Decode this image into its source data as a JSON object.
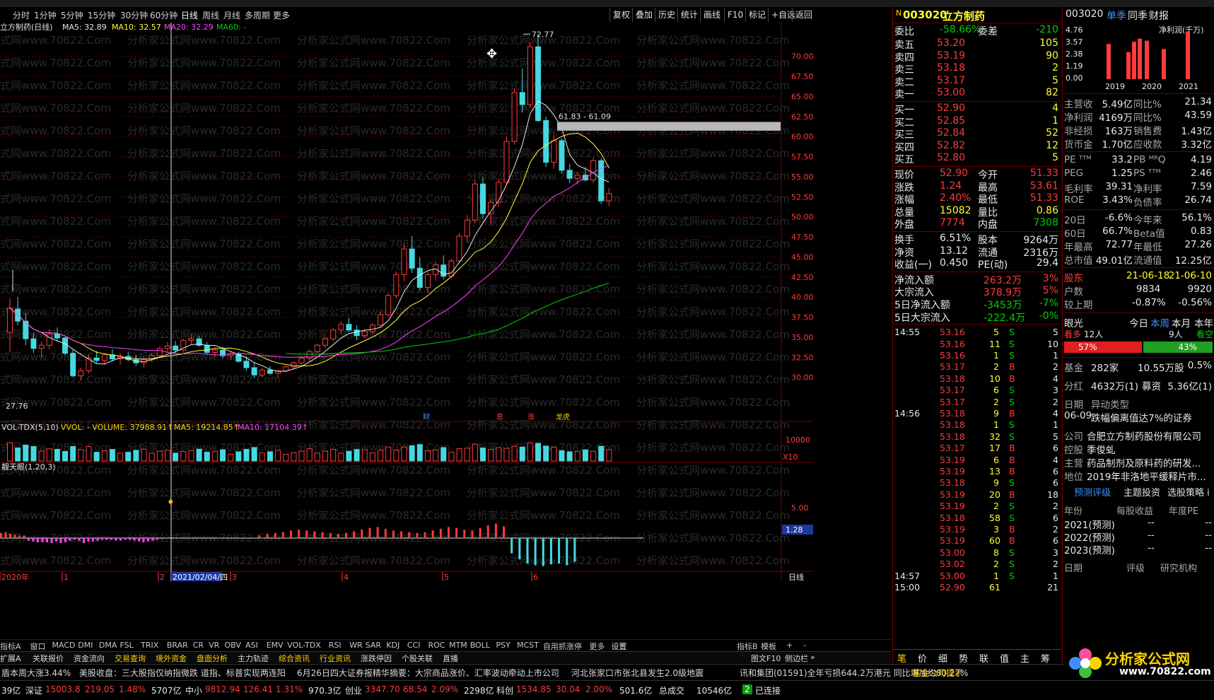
{
  "colors": {
    "up": "#ff3b3b",
    "down": "#44d9e0",
    "ma5": "#e8e8e8",
    "ma10": "#ffff30",
    "ma20": "#ff40ff",
    "ma60": "#00d000",
    "grid": "#7a0000"
  },
  "toolbar": {
    "periods": [
      "分时",
      "1分钟",
      "5分钟",
      "15分钟",
      "30分钟",
      "60分钟",
      "日线",
      "周线",
      "月线",
      "多周期",
      "更多"
    ],
    "active_period": "日线",
    "right_buttons": [
      "复权",
      "叠加",
      "历史",
      "统计",
      "画线",
      "F10",
      "标记",
      "+自选",
      "返回"
    ]
  },
  "chart": {
    "stock_label": "立方制药(日线)",
    "ma5": "MA5: 32.89",
    "ma10": "MA10: 32.57",
    "ma20": "MA20: 32.29",
    "ma60": "MA60: -",
    "high_label": "72.77",
    "low_label": "27.76",
    "gap_label": "61.83 - 61.09",
    "watermark": "分析家公式网www.70822.Com",
    "event_markers": [
      "财",
      "息",
      "涨",
      "龙虎"
    ],
    "vol_label": "VOL-TDX(5,10)",
    "vol_value": "VVOL: -   VOLUME: 37988.91↑",
    "vol_ma5": "MA5: 19214.85↑",
    "vol_ma10": "MA10: 17104.39↑",
    "vol_scale": "10000",
    "vol_unit": "X10",
    "ind_label": "靓天眼(1.20,3)",
    "ind_scale": "5.00",
    "ind_value": "1.28",
    "date_axis": [
      "2020年",
      "1",
      "2",
      "2021/02/04/四",
      "3",
      "4",
      "5",
      "6"
    ],
    "axis_unit": "日线"
  },
  "chart_data": {
    "type": "candlestick",
    "y_ticks": [
      70.0,
      67.5,
      65.0,
      62.5,
      60.0,
      57.5,
      55.0,
      52.5,
      50.0,
      47.5,
      45.0,
      42.5,
      40.0,
      37.5,
      35.0,
      32.5,
      30.0
    ],
    "ylim": [
      27.5,
      73.5
    ],
    "candles": [
      [
        35.6,
        39.8,
        33.2,
        38.6
      ],
      [
        38.5,
        40.0,
        36.5,
        37.0
      ],
      [
        37.0,
        38.0,
        34.0,
        34.8
      ],
      [
        34.8,
        35.5,
        33.0,
        33.6
      ],
      [
        33.6,
        34.5,
        32.5,
        34.0
      ],
      [
        34.0,
        36.0,
        33.5,
        35.4
      ],
      [
        35.4,
        36.2,
        34.5,
        34.9
      ],
      [
        34.9,
        35.0,
        32.8,
        33.0
      ],
      [
        33.0,
        33.5,
        30.0,
        30.2
      ],
      [
        30.2,
        31.2,
        29.6,
        30.8
      ],
      [
        30.8,
        32.8,
        30.5,
        32.4
      ],
      [
        32.4,
        33.3,
        31.8,
        32.1
      ],
      [
        32.1,
        33.0,
        31.5,
        32.8
      ],
      [
        32.8,
        33.5,
        32.0,
        32.3
      ],
      [
        32.3,
        33.0,
        31.6,
        32.6
      ],
      [
        32.6,
        33.2,
        32.0,
        32.2
      ],
      [
        32.2,
        32.8,
        31.4,
        31.8
      ],
      [
        31.8,
        32.5,
        31.2,
        32.3
      ],
      [
        32.3,
        33.0,
        31.9,
        32.7
      ],
      [
        32.7,
        33.8,
        32.4,
        33.6
      ],
      [
        33.6,
        34.4,
        33.2,
        33.9
      ],
      [
        33.9,
        34.5,
        33.0,
        33.4
      ],
      [
        33.4,
        34.8,
        33.2,
        34.6
      ],
      [
        34.6,
        35.4,
        34.0,
        34.8
      ],
      [
        34.8,
        35.2,
        33.8,
        34.0
      ],
      [
        34.0,
        34.4,
        32.8,
        33.1
      ],
      [
        33.1,
        33.8,
        32.6,
        33.4
      ],
      [
        33.4,
        33.8,
        32.4,
        32.7
      ],
      [
        32.7,
        33.2,
        32.2,
        32.9
      ],
      [
        32.9,
        33.2,
        31.8,
        32.0
      ],
      [
        32.0,
        32.6,
        30.8,
        31.2
      ],
      [
        31.2,
        31.8,
        29.9,
        30.3
      ],
      [
        30.3,
        31.2,
        30.0,
        30.9
      ],
      [
        30.9,
        31.4,
        30.3,
        30.5
      ],
      [
        30.5,
        31.0,
        30.0,
        30.8
      ],
      [
        30.8,
        31.5,
        30.6,
        31.3
      ],
      [
        31.3,
        32.0,
        31.0,
        31.8
      ],
      [
        31.8,
        32.6,
        31.5,
        32.4
      ],
      [
        32.4,
        33.5,
        32.0,
        33.2
      ],
      [
        33.2,
        34.2,
        33.0,
        34.0
      ],
      [
        34.0,
        35.0,
        33.6,
        34.8
      ],
      [
        34.8,
        36.2,
        34.5,
        35.9
      ],
      [
        35.9,
        37.0,
        35.4,
        36.6
      ],
      [
        36.6,
        37.4,
        35.6,
        35.9
      ],
      [
        35.9,
        36.5,
        34.6,
        35.2
      ],
      [
        35.2,
        36.0,
        34.8,
        35.7
      ],
      [
        35.7,
        36.8,
        35.4,
        36.5
      ],
      [
        36.5,
        38.2,
        36.2,
        37.8
      ],
      [
        37.8,
        40.5,
        37.5,
        40.2
      ],
      [
        40.2,
        43.2,
        39.8,
        42.8
      ],
      [
        42.8,
        46.6,
        42.0,
        46.0
      ],
      [
        46.0,
        47.6,
        43.0,
        43.6
      ],
      [
        43.6,
        45.0,
        40.8,
        41.2
      ],
      [
        41.2,
        43.2,
        40.5,
        42.8
      ],
      [
        42.8,
        44.5,
        42.0,
        44.0
      ],
      [
        44.0,
        45.2,
        42.2,
        42.6
      ],
      [
        42.6,
        44.8,
        42.4,
        44.5
      ],
      [
        44.5,
        48.0,
        44.2,
        47.6
      ],
      [
        47.6,
        50.2,
        46.8,
        49.6
      ],
      [
        49.6,
        54.6,
        49.2,
        54.1
      ],
      [
        54.1,
        55.0,
        49.8,
        50.4
      ],
      [
        50.4,
        52.2,
        49.0,
        51.8
      ],
      [
        51.8,
        54.8,
        51.2,
        54.3
      ],
      [
        54.3,
        60.0,
        54.0,
        59.4
      ],
      [
        59.4,
        66.0,
        59.0,
        65.5
      ],
      [
        65.5,
        68.5,
        63.0,
        64.0
      ],
      [
        64.0,
        71.8,
        63.6,
        71.2
      ],
      [
        71.2,
        72.77,
        61.8,
        62.0
      ],
      [
        62.0,
        62.5,
        56.2,
        56.8
      ],
      [
        56.8,
        60.2,
        56.0,
        59.5
      ],
      [
        59.5,
        59.8,
        55.4,
        55.8
      ],
      [
        55.8,
        56.6,
        54.2,
        54.8
      ],
      [
        54.8,
        55.6,
        54.0,
        55.2
      ],
      [
        55.2,
        56.2,
        54.4,
        54.6
      ],
      [
        54.6,
        57.4,
        54.2,
        57.0
      ],
      [
        57.0,
        57.3,
        51.6,
        52.0
      ],
      [
        52.0,
        53.61,
        51.33,
        52.9
      ]
    ],
    "ind_bars": [
      0.6,
      0.7,
      0.5,
      0.4,
      0.3,
      0.3,
      -0.3,
      -0.4,
      -0.5,
      -0.5,
      -0.5,
      -0.6,
      -0.4,
      -0.6,
      -0.5,
      -0.3,
      -0.2,
      -0.3,
      -0.6,
      -0.4,
      -0.4,
      -0.3,
      -0.2,
      -0.2,
      -0.2,
      -0.3,
      -0.3,
      -0.2,
      -0.2,
      -0.3,
      -0.4,
      -0.5,
      -0.4,
      -0.3,
      -0.2,
      -0.1,
      0.3,
      0.5,
      0.6,
      0.7,
      0.9,
      1.0,
      0.9,
      0.8,
      0.7,
      0.6,
      0.5,
      0.6,
      0.8,
      1.0,
      1.2,
      1.3,
      1.1,
      0.9,
      0.8,
      0.7,
      0.6,
      0.7,
      0.9,
      1.1,
      1.3,
      1.2,
      1.0,
      0.9,
      1.2,
      1.5,
      1.7,
      1.4,
      -1.8,
      -2.5,
      -3.0,
      -3.2,
      -3.3,
      -3.1,
      -3.0,
      -3.2,
      -2.8
    ]
  },
  "quote": {
    "code": "003020",
    "name": "立方制药",
    "weibi_label": "委比",
    "weibi": "-58.66%",
    "weicha_label": "委差",
    "weicha": "-210",
    "asks": [
      {
        "l": "卖五",
        "p": "53.20",
        "v": "105"
      },
      {
        "l": "卖四",
        "p": "53.19",
        "v": "90"
      },
      {
        "l": "卖三",
        "p": "53.18",
        "v": "2"
      },
      {
        "l": "卖二",
        "p": "53.17",
        "v": "5"
      },
      {
        "l": "卖一",
        "p": "53.00",
        "v": "82"
      }
    ],
    "bids": [
      {
        "l": "买一",
        "p": "52.90",
        "v": "4"
      },
      {
        "l": "买二",
        "p": "52.85",
        "v": "1"
      },
      {
        "l": "买三",
        "p": "52.84",
        "v": "52"
      },
      {
        "l": "买四",
        "p": "52.82",
        "v": "12"
      },
      {
        "l": "买五",
        "p": "52.80",
        "v": "5"
      }
    ],
    "stats": [
      {
        "a": "现价",
        "b": "52.90",
        "c": "今开",
        "d": "51.33"
      },
      {
        "a": "涨跌",
        "b": "1.24",
        "c": "最高",
        "d": "53.61"
      },
      {
        "a": "涨幅",
        "b": "2.40%",
        "c": "最低",
        "d": "51.33"
      },
      {
        "a": "总量",
        "b": "15082",
        "c": "量比",
        "d": "0.86"
      },
      {
        "a": "外盘",
        "b": "7774",
        "c": "内盘",
        "d": "7308"
      }
    ],
    "stats2": [
      {
        "a": "换手",
        "b": "6.51%",
        "c": "股本",
        "d": "9264万"
      },
      {
        "a": "净资",
        "b": "13.12",
        "c": "流通",
        "d": "2316万"
      },
      {
        "a": "收益(一)",
        "b": "0.450",
        "c": "PE(动)",
        "d": "29.4"
      }
    ],
    "flows": [
      {
        "a": "净流入额",
        "b": "263.2万",
        "c": "3%"
      },
      {
        "a": "大宗流入",
        "b": "378.9万",
        "c": "5%"
      },
      {
        "a": "5日净流入额",
        "b": "-3453万",
        "c": "-7%"
      },
      {
        "a": "5日大宗流入",
        "b": "-222.4万",
        "c": "-0%"
      }
    ],
    "ticks": [
      {
        "t": "14:55",
        "p": "53.16",
        "v": "5",
        "s": "S",
        "n": "5"
      },
      {
        "t": "",
        "p": "53.16",
        "v": "11",
        "s": "S",
        "n": "10"
      },
      {
        "t": "",
        "p": "53.16",
        "v": "1",
        "s": "S",
        "n": "1"
      },
      {
        "t": "",
        "p": "53.17",
        "v": "2",
        "s": "B",
        "n": "2"
      },
      {
        "t": "",
        "p": "53.18",
        "v": "10",
        "s": "B",
        "n": "4"
      },
      {
        "t": "",
        "p": "53.17",
        "v": "6",
        "s": "S",
        "n": "3"
      },
      {
        "t": "",
        "p": "53.17",
        "v": "2",
        "s": "S",
        "n": "2"
      },
      {
        "t": "14:56",
        "p": "53.18",
        "v": "9",
        "s": "B",
        "n": "4"
      },
      {
        "t": "",
        "p": "53.18",
        "v": "1",
        "s": "S",
        "n": "1"
      },
      {
        "t": "",
        "p": "53.18",
        "v": "32",
        "s": "S",
        "n": "5"
      },
      {
        "t": "",
        "p": "53.17",
        "v": "17",
        "s": "B",
        "n": "6"
      },
      {
        "t": "",
        "p": "53.19",
        "v": "6",
        "s": "B",
        "n": "4"
      },
      {
        "t": "",
        "p": "53.19",
        "v": "13",
        "s": "B",
        "n": "6"
      },
      {
        "t": "",
        "p": "53.18",
        "v": "9",
        "s": "S",
        "n": "6"
      },
      {
        "t": "",
        "p": "53.19",
        "v": "20",
        "s": "B",
        "n": "18"
      },
      {
        "t": "",
        "p": "53.19",
        "v": "2",
        "s": "S",
        "n": "2"
      },
      {
        "t": "",
        "p": "53.18",
        "v": "58",
        "s": "S",
        "n": "6"
      },
      {
        "t": "",
        "p": "53.19",
        "v": "3",
        "s": "B",
        "n": "2"
      },
      {
        "t": "",
        "p": "53.19",
        "v": "60",
        "s": "B",
        "n": "6"
      },
      {
        "t": "",
        "p": "53.00",
        "v": "8",
        "s": "S",
        "n": "3"
      },
      {
        "t": "",
        "p": "53.02",
        "v": "2",
        "s": "S",
        "n": "2"
      },
      {
        "t": "14:57",
        "p": "53.00",
        "v": "1",
        "s": "S",
        "n": "1"
      },
      {
        "t": "15:00",
        "p": "52.90",
        "v": "61",
        "s": "",
        "n": "21"
      }
    ],
    "bottom_tabs": [
      "笔",
      "价",
      "细",
      "势",
      "联",
      "值",
      "主",
      "筹"
    ]
  },
  "f10": {
    "code": "003020",
    "tabs": [
      "单季",
      "同季",
      "财报"
    ],
    "profit_title": "净利润(千万)",
    "profit_ticks": [
      "4.76",
      "3.57",
      "2.38",
      "1.19",
      "0.00"
    ],
    "profit_years": [
      "2019",
      "2020",
      "2021"
    ],
    "profit_bars": [
      3.4,
      2.6,
      3.6,
      3.9,
      3.7,
      2.9,
      4.6
    ],
    "fin": [
      {
        "a": "主营收",
        "b": "5.49亿",
        "c": "同比%",
        "d": "21.34"
      },
      {
        "a": "净利润",
        "b": "4169万",
        "c": "同比%",
        "d": "43.59"
      },
      {
        "a": "非经损",
        "b": "163万",
        "c": "销售费",
        "d": "1.43亿"
      },
      {
        "a": "货币金",
        "b": "1.70亿",
        "c": "应收款",
        "d": "3.32亿"
      }
    ],
    "val": [
      {
        "a": "PE ᵀᵀᴹ",
        "b": "33.2",
        "c": "PB ᴹᴿQ",
        "d": "4.19"
      },
      {
        "a": "PEG",
        "b": "1.25",
        "c": "PS ᵀᵀᴹ",
        "d": "2.46"
      },
      {
        "a": "毛利率",
        "b": "39.31",
        "c": "净利率",
        "d": "7.59"
      },
      {
        "a": "ROE",
        "b": "3.43%",
        "c": "负债率",
        "d": "26.74"
      }
    ],
    "perf": [
      {
        "a": "20日",
        "b": "-6.6%",
        "c": "今年来",
        "d": "56.1%"
      },
      {
        "a": "60日",
        "b": "66.7%",
        "c": "Beta值",
        "d": "0.83"
      },
      {
        "a": "年最高",
        "b": "72.77",
        "c": "年最低",
        "d": "27.26"
      },
      {
        "a": "总市值",
        "b": "49.01亿",
        "c": "流通值",
        "d": "12.25亿"
      }
    ],
    "holders": {
      "label": "股东",
      "d1": "21-06-18",
      "d2": "21-06-10",
      "hu_label": "户数",
      "hu1": "9834",
      "hu2": "9920",
      "jiao_label": "较上期",
      "j1": "-0.87%",
      "j2": "-0.56%"
    },
    "eye": {
      "label": "眼光",
      "t1": "今日",
      "t2": "本周",
      "t3": "本月",
      "t4": "本年",
      "bull": "看多",
      "bull_n": "12人",
      "bear_n": "9人",
      "bear": "看空",
      "bull_pct": "57%",
      "bear_pct": "43%"
    },
    "fund": {
      "a": "基金",
      "b": "282家",
      "c": "10.55万股",
      "d": "0.5%"
    },
    "div": {
      "a": "分红",
      "b": "4632万(1)",
      "c": "募资",
      "d": "5.36亿(1)"
    },
    "abn": {
      "h1": "日期",
      "h2": "异动类型",
      "date": "06-09",
      "type": "跌幅偏离值达7%的证券"
    },
    "company": [
      {
        "a": "公司",
        "b": "合肥立方制药股份有限公司"
      },
      {
        "a": "控股",
        "b": "季俊虬"
      },
      {
        "a": "主营",
        "b": "药品制剂及原料药的研发..."
      },
      {
        "a": "地位",
        "b": "2019年非洛地平缓释片市..."
      }
    ],
    "links": [
      "预测评级",
      "主题投资",
      "选股策略 i"
    ],
    "forecast_head": [
      "年份",
      "每股收益",
      "年度PE"
    ],
    "forecast": [
      {
        "y": "2021(预测)",
        "e": "--",
        "p": "--"
      },
      {
        "y": "2022(预测)",
        "e": "--",
        "p": "--"
      },
      {
        "y": "2023(预测)",
        "e": "--",
        "p": "--"
      }
    ],
    "rating_head": [
      "日期",
      "评级",
      "研究机构"
    ]
  },
  "indicators": [
    "指标A",
    "窗口",
    "MACD",
    "DMI",
    "DMA",
    "FSL",
    "TRIX",
    "BRAR",
    "CR",
    "VR",
    "OBV",
    "ASI",
    "EMV",
    "VOL-TDX",
    "RSI",
    "WR",
    "SAR",
    "KDJ",
    "CCI",
    "ROC",
    "MTM",
    "BOLL",
    "PSY",
    "MCST",
    "自用抓涨停",
    "更多",
    "设置"
  ],
  "ind_right": [
    "指标B",
    "模板",
    "+",
    "-"
  ],
  "subtabs": [
    "扩展A",
    "关联报价",
    "资金流向",
    "交易查询",
    "境外资金",
    "盘面分析",
    "主力轨迹",
    "综合资讯",
    "行业资讯",
    "涨跌停因",
    "个股关联",
    "直播"
  ],
  "subtab_right": [
    "图文F10",
    "侧边栏",
    "»"
  ],
  "news": [
    "盾本周大涨3.44%",
    "美股收盘：三大股指仅纳指微跌 道指、标普实现两连阳",
    "6月26日四大证券报精华摘要：大宗商品涨价、汇率波动牵动上市公司",
    "河北张家口市张北县发生2.0级地震",
    "讯和集团(01591)全年亏损644.2万港元 同比增加约80.27%",
    "基金公司提示"
  ],
  "status": {
    "s0": "39亿",
    "sz_label": "深证",
    "sz": "15003.8",
    "sz_ch": "219.05",
    "sz_pct": "1.48%",
    "sz_amt": "5707亿",
    "zx_label": "中小",
    "zx": "9812.94",
    "zx_ch": "126.41",
    "zx_pct": "1.31%",
    "zx_amt": "970.3亿",
    "cy_label": "创业",
    "cy": "3347.70",
    "cy_ch": "68.54",
    "cy_pct": "2.09%",
    "cy_amt": "2298亿",
    "kc_label": "科创",
    "kc": "1534.85",
    "kc_ch": "30.04",
    "kc_pct": "2.00%",
    "kc_amt": "501.6亿",
    "total_label": "总成交",
    "total": "10546亿",
    "conn": "已连接",
    "conn_n": "2"
  },
  "logo": {
    "text": "分析家公式网",
    "url": "www.70822.com"
  }
}
